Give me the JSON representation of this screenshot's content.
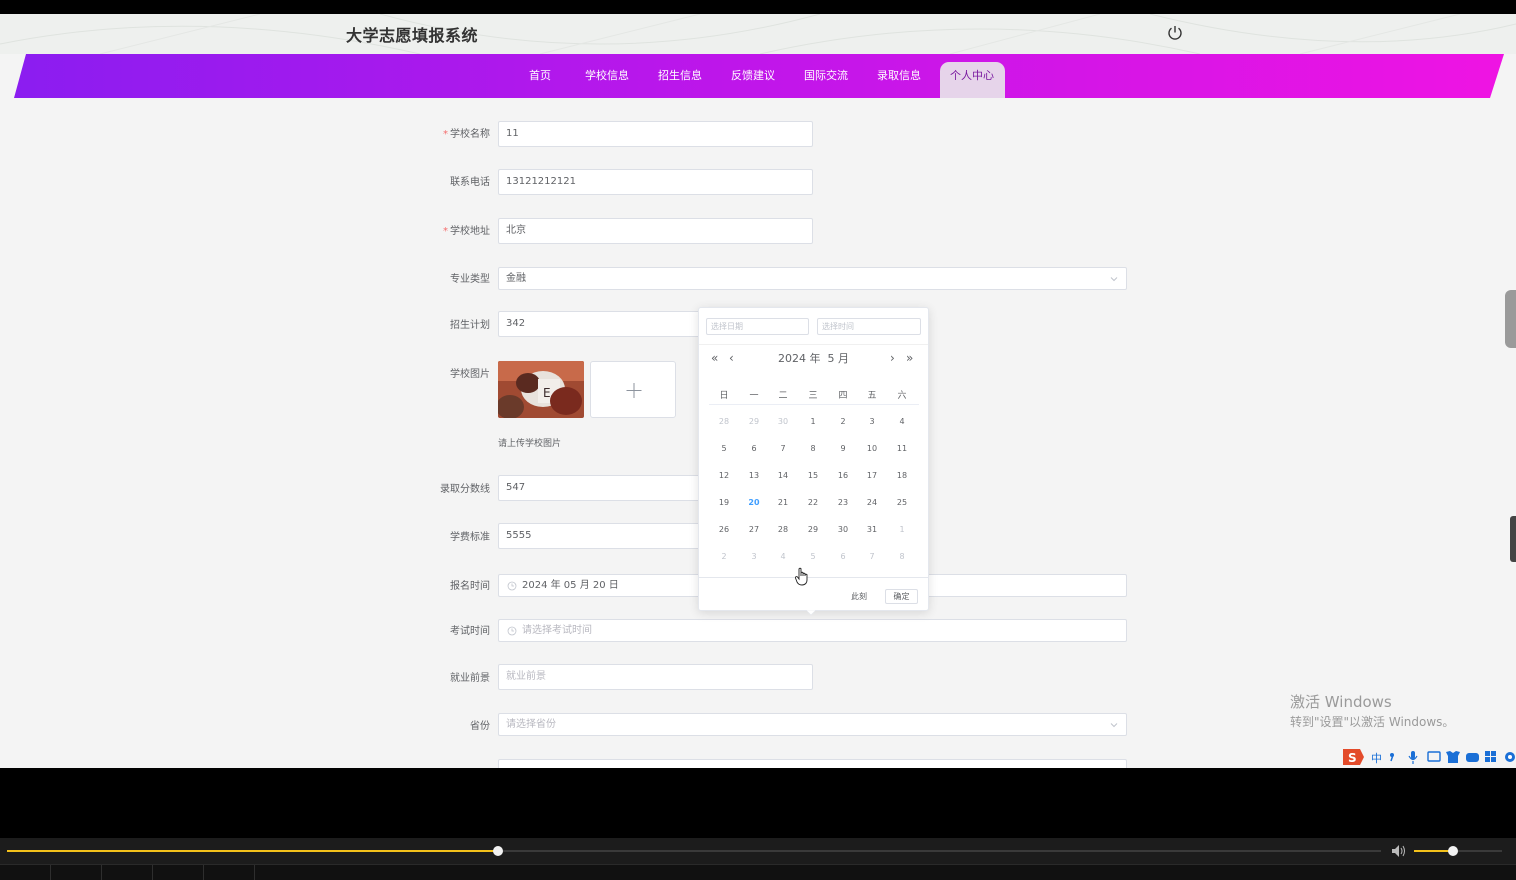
{
  "header": {
    "title": "大学志愿填报系统"
  },
  "nav": {
    "items": [
      "首页",
      "学校信息",
      "招生信息",
      "反馈建议",
      "国际交流",
      "录取信息",
      "个人中心"
    ],
    "active": "个人中心"
  },
  "form": {
    "school_name": {
      "label": "学校名称",
      "required": "*",
      "value": "11"
    },
    "phone": {
      "label": "联系电话",
      "value": "13121212121"
    },
    "address": {
      "label": "学校地址",
      "required": "*",
      "value": "北京"
    },
    "major_type": {
      "label": "专业类型",
      "value": "金融"
    },
    "plan": {
      "label": "招生计划",
      "value": "342"
    },
    "school_image": {
      "label": "学校图片",
      "hint": "请上传学校图片"
    },
    "score_line": {
      "label": "录取分数线",
      "value": "547"
    },
    "tuition": {
      "label": "学费标准",
      "value": "5555"
    },
    "signup_time": {
      "label": "报名时间",
      "value": "2024 年 05 月 20 日"
    },
    "exam_time": {
      "label": "考试时间",
      "placeholder": "请选择考试时间"
    },
    "employment": {
      "label": "就业前景",
      "placeholder": "就业前景"
    },
    "province": {
      "label": "省份",
      "placeholder": "请选择省份"
    }
  },
  "datepicker": {
    "date_placeholder": "选择日期",
    "time_placeholder": "选择时间",
    "year": "2024 年",
    "month": "5 月",
    "weekdays": [
      "日",
      "一",
      "二",
      "三",
      "四",
      "五",
      "六"
    ],
    "weeks": [
      [
        "28",
        "29",
        "30",
        "1",
        "2",
        "3",
        "4"
      ],
      [
        "5",
        "6",
        "7",
        "8",
        "9",
        "10",
        "11"
      ],
      [
        "12",
        "13",
        "14",
        "15",
        "16",
        "17",
        "18"
      ],
      [
        "19",
        "20",
        "21",
        "22",
        "23",
        "24",
        "25"
      ],
      [
        "26",
        "27",
        "28",
        "29",
        "30",
        "31",
        "1"
      ],
      [
        "2",
        "3",
        "4",
        "5",
        "6",
        "7",
        "8"
      ]
    ],
    "today": "20",
    "now_label": "此刻",
    "confirm_label": "确定"
  },
  "watermark": {
    "line1": "激活 Windows",
    "line2": "转到\"设置\"以激活 Windows。"
  },
  "ime": {
    "lang": "中"
  },
  "player": {
    "progress": 0.357,
    "volume": 0.44
  },
  "colors": {
    "nav_gradient_start": "#8b1df0",
    "nav_gradient_end": "#ef14e3",
    "today": "#409eff",
    "required": "#f56c6c",
    "seek": "#f3c11b"
  }
}
